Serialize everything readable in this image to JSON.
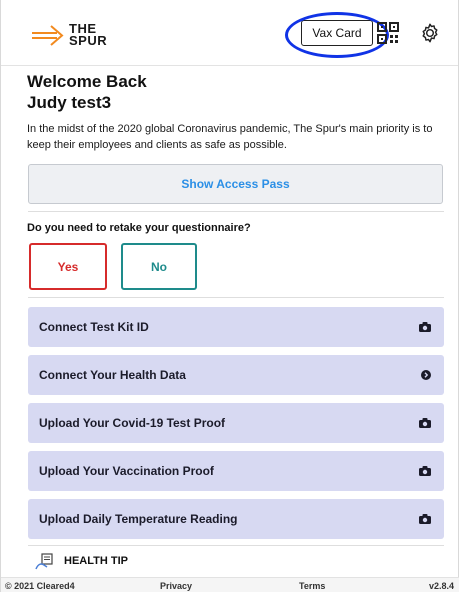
{
  "header": {
    "logo_line1": "THE",
    "logo_line2": "SPUR",
    "vax_card_label": "Vax Card",
    "icons": [
      "qr-code-icon",
      "gear-icon"
    ]
  },
  "welcome": {
    "greeting": "Welcome Back",
    "username": "Judy test3",
    "intro": "In the midst of the 2020 global Coronavirus pandemic, The Spur's main priority is to keep their employees and clients as safe as possible."
  },
  "access_pass_label": "Show Access Pass",
  "questionnaire": {
    "question": "Do you need to retake your questionnaire?",
    "yes_label": "Yes",
    "no_label": "No"
  },
  "actions": [
    {
      "label": "Connect Test Kit ID",
      "icon": "camera-icon"
    },
    {
      "label": "Connect Your Health Data",
      "icon": "arrow-right-icon"
    },
    {
      "label": "Upload Your Covid-19 Test Proof",
      "icon": "camera-icon"
    },
    {
      "label": "Upload Your Vaccination Proof",
      "icon": "camera-icon"
    },
    {
      "label": "Upload Daily Temperature Reading",
      "icon": "camera-icon"
    }
  ],
  "health_tip_label": "HEALTH TIP",
  "footer": {
    "copyright": "© 2021 Cleared4",
    "privacy": "Privacy",
    "terms": "Terms",
    "version": "v2.8.4"
  },
  "colors": {
    "accent_blue": "#2b8fe6",
    "highlight_circle": "#1033e6",
    "yes_red": "#d62b2b",
    "no_teal": "#1e8b8b",
    "action_bg": "#d7d9f2",
    "logo_orange": "#f28a1f"
  }
}
